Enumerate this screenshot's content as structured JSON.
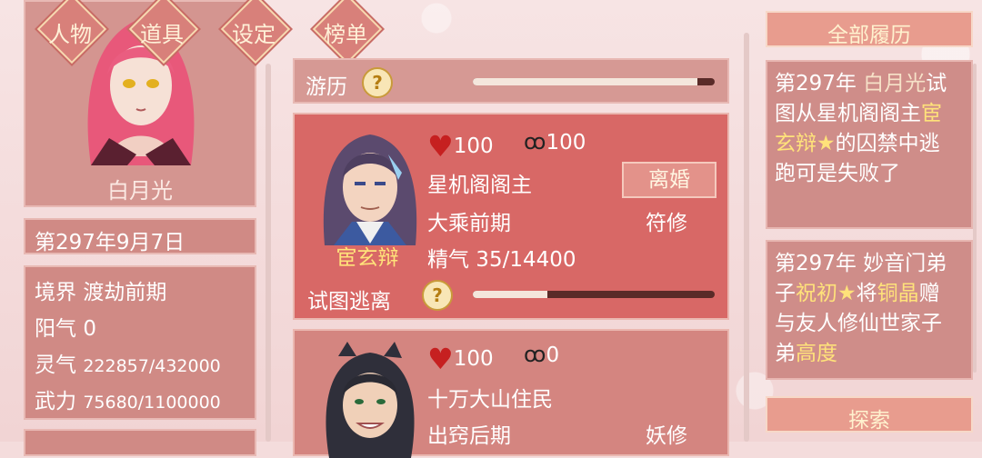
{
  "nav": {
    "tabs": [
      "人物",
      "道具",
      "设定",
      "榜单"
    ]
  },
  "hero": {
    "name": "白月光"
  },
  "date": "第297年9月7日",
  "stats": {
    "realm_label": "境界",
    "realm_value": "渡劫前期",
    "yang_label": "阳气",
    "yang_value": "0",
    "qi_label": "灵气",
    "qi_value": "222857/432000",
    "power_label": "武力",
    "power_value": "75680/1100000"
  },
  "travel": {
    "label": "游历",
    "help": "?",
    "progress": 0.93
  },
  "npcs": [
    {
      "name": "宦玄辩",
      "hp": "100",
      "bond": "100",
      "title": "星机阁阁主",
      "realm": "大乘前期",
      "class": "符修",
      "essence": "精气 35/14400",
      "action_button": "离婚",
      "escape_label": "试图逃离",
      "help": "?",
      "escape_progress": 0.31
    },
    {
      "name": "",
      "hp": "100",
      "bond": "0",
      "title": "十万大山住民",
      "realm": "出窍后期",
      "class": "妖修"
    }
  ],
  "history": {
    "header": "全部履历",
    "entries": [
      {
        "year": "第297年",
        "subject": "白月光",
        "text_a": "试图从星机阁阁主",
        "name": "宦玄辩",
        "star": "★",
        "text_b": "的囚禁中逃跑可是失败了"
      },
      {
        "year": "第297年",
        "text_a": "妙音门弟子",
        "name": "祝初",
        "star": "★",
        "text_b": "将",
        "item": "铜晶",
        "text_c": "赠与友人修仙世家子弟",
        "target": "高度"
      }
    ],
    "explore_button": "探索"
  },
  "icons": {
    "hp": "heart-icon",
    "bond": "handcuffs-icon",
    "help": "question-icon"
  },
  "colors": {
    "card": "#d08a85",
    "active_card": "#d86866",
    "gold": "#ffe27a",
    "heart": "#c62020"
  }
}
